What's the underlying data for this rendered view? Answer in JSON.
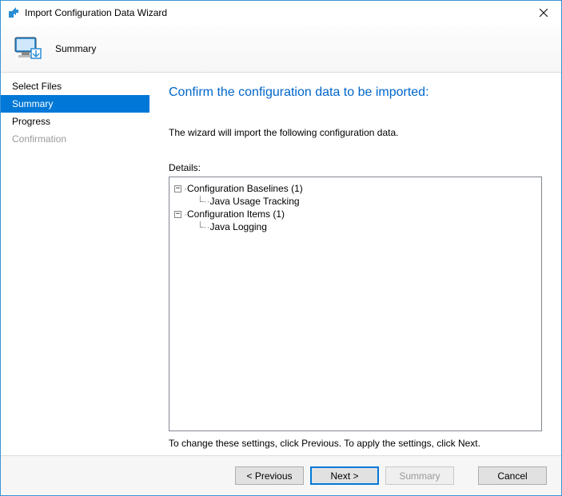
{
  "window": {
    "title": "Import Configuration Data Wizard"
  },
  "header": {
    "title": "Summary"
  },
  "sidebar": {
    "items": [
      {
        "label": "Select Files",
        "state": "normal"
      },
      {
        "label": "Summary",
        "state": "selected"
      },
      {
        "label": "Progress",
        "state": "normal"
      },
      {
        "label": "Confirmation",
        "state": "disabled"
      }
    ]
  },
  "content": {
    "heading": "Confirm the configuration data to be imported:",
    "intro": "The wizard will import the following configuration data.",
    "details_label": "Details:",
    "tree": {
      "node1": {
        "label": "Configuration Baselines (1)",
        "child": "Java Usage Tracking"
      },
      "node2": {
        "label": "Configuration Items (1)",
        "child": "Java Logging"
      }
    },
    "hint": "To change these settings, click Previous. To apply the settings, click Next."
  },
  "footer": {
    "previous": "< Previous",
    "next": "Next >",
    "summary": "Summary",
    "cancel": "Cancel"
  }
}
